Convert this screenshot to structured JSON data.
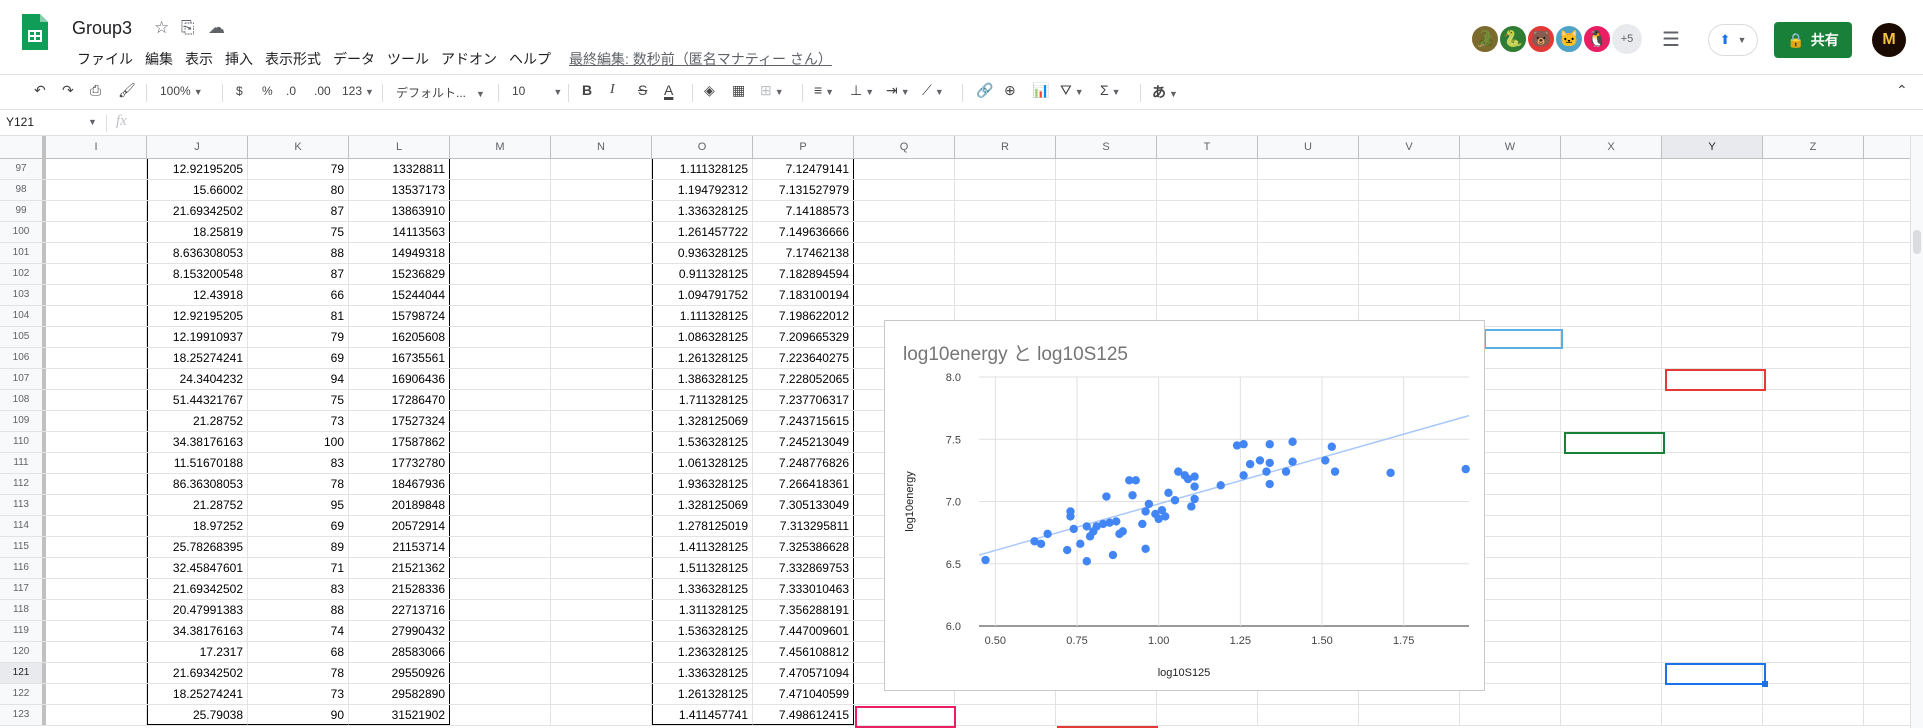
{
  "app": {
    "title": "Group3",
    "menu": [
      "ファイル",
      "編集",
      "表示",
      "挿入",
      "表示形式",
      "データ",
      "ツール",
      "アドオン",
      "ヘルプ"
    ],
    "last_edit": "最終編集: 数秒前（匿名マナティー さん）",
    "more_collaborators": "+5",
    "share_label": "共有",
    "collaborator_colors": [
      "#7c6a2e",
      "#2e7d32",
      "#e53935",
      "#4fa3c7",
      "#e91e63"
    ]
  },
  "toolbar": {
    "zoom": "100%",
    "currency": "$",
    "percent": "%",
    "dec_decrease": ".0",
    "dec_increase": ".00",
    "more_formats": "123",
    "font": "デフォルト...",
    "font_size": "10",
    "bold": "B",
    "italic": "I",
    "strike": "S",
    "text_color": "A",
    "input_tools": "あ"
  },
  "formula_bar": {
    "name_box": "Y121",
    "fx": "fx",
    "value": ""
  },
  "columns": [
    "I",
    "J",
    "K",
    "L",
    "M",
    "N",
    "O",
    "P",
    "Q",
    "R",
    "S",
    "T",
    "U",
    "V",
    "W",
    "X",
    "Y",
    "Z"
  ],
  "rows": [
    {
      "n": "97",
      "J": "12.92195205",
      "K": "79",
      "L": "13328811",
      "O": "1.111328125",
      "P": "7.12479141"
    },
    {
      "n": "98",
      "J": "15.66002",
      "K": "80",
      "L": "13537173",
      "O": "1.194792312",
      "P": "7.131527979"
    },
    {
      "n": "99",
      "J": "21.69342502",
      "K": "87",
      "L": "13863910",
      "O": "1.336328125",
      "P": "7.14188573"
    },
    {
      "n": "100",
      "J": "18.25819",
      "K": "75",
      "L": "14113563",
      "O": "1.261457722",
      "P": "7.149636666"
    },
    {
      "n": "101",
      "J": "8.636308053",
      "K": "88",
      "L": "14949318",
      "O": "0.936328125",
      "P": "7.17462138"
    },
    {
      "n": "102",
      "J": "8.153200548",
      "K": "87",
      "L": "15236829",
      "O": "0.911328125",
      "P": "7.182894594"
    },
    {
      "n": "103",
      "J": "12.43918",
      "K": "66",
      "L": "15244044",
      "O": "1.094791752",
      "P": "7.183100194"
    },
    {
      "n": "104",
      "J": "12.92195205",
      "K": "81",
      "L": "15798724",
      "O": "1.111328125",
      "P": "7.198622012"
    },
    {
      "n": "105",
      "J": "12.19910937",
      "K": "79",
      "L": "16205608",
      "O": "1.086328125",
      "P": "7.209665329"
    },
    {
      "n": "106",
      "J": "18.25274241",
      "K": "69",
      "L": "16735561",
      "O": "1.261328125",
      "P": "7.223640275"
    },
    {
      "n": "107",
      "J": "24.3404232",
      "K": "94",
      "L": "16906436",
      "O": "1.386328125",
      "P": "7.228052065"
    },
    {
      "n": "108",
      "J": "51.44321767",
      "K": "75",
      "L": "17286470",
      "O": "1.711328125",
      "P": "7.237706317"
    },
    {
      "n": "109",
      "J": "21.28752",
      "K": "73",
      "L": "17527324",
      "O": "1.328125069",
      "P": "7.243715615"
    },
    {
      "n": "110",
      "J": "34.38176163",
      "K": "100",
      "L": "17587862",
      "O": "1.536328125",
      "P": "7.245213049"
    },
    {
      "n": "111",
      "J": "11.51670188",
      "K": "83",
      "L": "17732780",
      "O": "1.061328125",
      "P": "7.248776826"
    },
    {
      "n": "112",
      "J": "86.36308053",
      "K": "78",
      "L": "18467936",
      "O": "1.936328125",
      "P": "7.266418361"
    },
    {
      "n": "113",
      "J": "21.28752",
      "K": "95",
      "L": "20189848",
      "O": "1.328125069",
      "P": "7.305133049"
    },
    {
      "n": "114",
      "J": "18.97252",
      "K": "69",
      "L": "20572914",
      "O": "1.278125019",
      "P": "7.313295811"
    },
    {
      "n": "115",
      "J": "25.78268395",
      "K": "89",
      "L": "21153714",
      "O": "1.411328125",
      "P": "7.325386628"
    },
    {
      "n": "116",
      "J": "32.45847601",
      "K": "71",
      "L": "21521362",
      "O": "1.511328125",
      "P": "7.332869753"
    },
    {
      "n": "117",
      "J": "21.69342502",
      "K": "83",
      "L": "21528336",
      "O": "1.336328125",
      "P": "7.333010463"
    },
    {
      "n": "118",
      "J": "20.47991383",
      "K": "88",
      "L": "22713716",
      "O": "1.311328125",
      "P": "7.356288191"
    },
    {
      "n": "119",
      "J": "34.38176163",
      "K": "74",
      "L": "27990432",
      "O": "1.536328125",
      "P": "7.447009601"
    },
    {
      "n": "120",
      "J": "17.2317",
      "K": "68",
      "L": "28583066",
      "O": "1.236328125",
      "P": "7.456108812"
    },
    {
      "n": "121",
      "J": "21.69342502",
      "K": "78",
      "L": "29550926",
      "O": "1.336328125",
      "P": "7.470571094"
    },
    {
      "n": "122",
      "J": "18.25274241",
      "K": "73",
      "L": "29582890",
      "O": "1.261328125",
      "P": "7.471040599"
    },
    {
      "n": "123",
      "J": "25.79038",
      "K": "90",
      "L": "31521902",
      "O": "1.411457741",
      "P": "7.498612415"
    }
  ],
  "chart_data": {
    "type": "scatter",
    "title": "log10energy と log10S125",
    "xlabel": "log10S125",
    "ylabel": "log10energy",
    "xlim": [
      0.45,
      1.95
    ],
    "ylim": [
      6.0,
      8.0
    ],
    "xticks": [
      "0.50",
      "0.75",
      "1.00",
      "1.25",
      "1.50",
      "1.75"
    ],
    "yticks": [
      "6.0",
      "6.5",
      "7.0",
      "7.5",
      "8.0"
    ],
    "trendline": {
      "x": [
        0.45,
        1.95
      ],
      "y": [
        6.57,
        7.69
      ]
    },
    "series_color": "#4285f4",
    "trend_color": "#a8c7fa",
    "points": [
      [
        0.47,
        6.53
      ],
      [
        0.62,
        6.68
      ],
      [
        0.64,
        6.66
      ],
      [
        0.66,
        6.74
      ],
      [
        0.72,
        6.61
      ],
      [
        0.73,
        6.88
      ],
      [
        0.73,
        6.92
      ],
      [
        0.74,
        6.78
      ],
      [
        0.76,
        6.66
      ],
      [
        0.78,
        6.52
      ],
      [
        0.78,
        6.8
      ],
      [
        0.79,
        6.72
      ],
      [
        0.8,
        6.76
      ],
      [
        0.81,
        6.8
      ],
      [
        0.83,
        6.82
      ],
      [
        0.84,
        7.04
      ],
      [
        0.85,
        6.83
      ],
      [
        0.86,
        6.57
      ],
      [
        0.87,
        6.84
      ],
      [
        0.88,
        6.74
      ],
      [
        0.89,
        6.76
      ],
      [
        0.91,
        7.17
      ],
      [
        0.92,
        7.05
      ],
      [
        0.93,
        7.17
      ],
      [
        0.95,
        6.82
      ],
      [
        0.96,
        6.62
      ],
      [
        0.96,
        6.92
      ],
      [
        0.97,
        6.98
      ],
      [
        0.99,
        6.9
      ],
      [
        1.0,
        6.86
      ],
      [
        1.01,
        6.93
      ],
      [
        1.02,
        6.88
      ],
      [
        1.03,
        7.07
      ],
      [
        1.05,
        7.01
      ],
      [
        1.06,
        7.24
      ],
      [
        1.08,
        7.21
      ],
      [
        1.09,
        7.18
      ],
      [
        1.1,
        6.96
      ],
      [
        1.11,
        7.2
      ],
      [
        1.11,
        7.02
      ],
      [
        1.11,
        7.12
      ],
      [
        1.19,
        7.13
      ],
      [
        1.24,
        7.45
      ],
      [
        1.26,
        7.46
      ],
      [
        1.26,
        7.21
      ],
      [
        1.28,
        7.3
      ],
      [
        1.31,
        7.33
      ],
      [
        1.33,
        7.24
      ],
      [
        1.34,
        7.31
      ],
      [
        1.34,
        7.46
      ],
      [
        1.34,
        7.14
      ],
      [
        1.39,
        7.24
      ],
      [
        1.41,
        7.48
      ],
      [
        1.41,
        7.32
      ],
      [
        1.51,
        7.33
      ],
      [
        1.53,
        7.44
      ],
      [
        1.54,
        7.24
      ],
      [
        1.71,
        7.23
      ],
      [
        1.94,
        7.26
      ]
    ]
  }
}
